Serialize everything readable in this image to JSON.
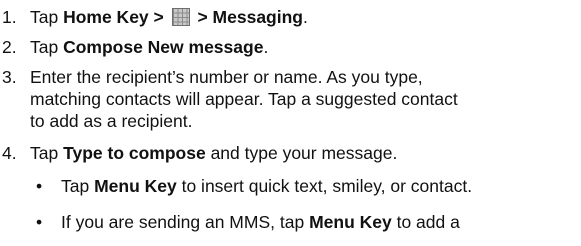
{
  "steps": [
    {
      "num": "1.",
      "pre": "Tap ",
      "b1": "Home Key > ",
      "icon": "app-grid-icon",
      "b2": " > Messaging",
      "post": "."
    },
    {
      "num": "2.",
      "pre": "Tap ",
      "b1": "Compose New message",
      "post": "."
    },
    {
      "num": "3.",
      "line1": "Enter the recipient’s number or name. As you type,",
      "line2": "matching contacts will appear. Tap a suggested contact",
      "line3": "to add as a recipient."
    },
    {
      "num": "4.",
      "pre": "Tap ",
      "b1": "Type to compose",
      "post": " and type your message."
    }
  ],
  "bullets": [
    {
      "symbol": "•",
      "pre": "Tap ",
      "b1": "Menu Key",
      "post": " to insert quick text, smiley, or contact."
    },
    {
      "symbol": "•",
      "pre": "If you are sending an MMS, tap ",
      "b1": "Menu Key",
      "post": " to add a"
    }
  ]
}
